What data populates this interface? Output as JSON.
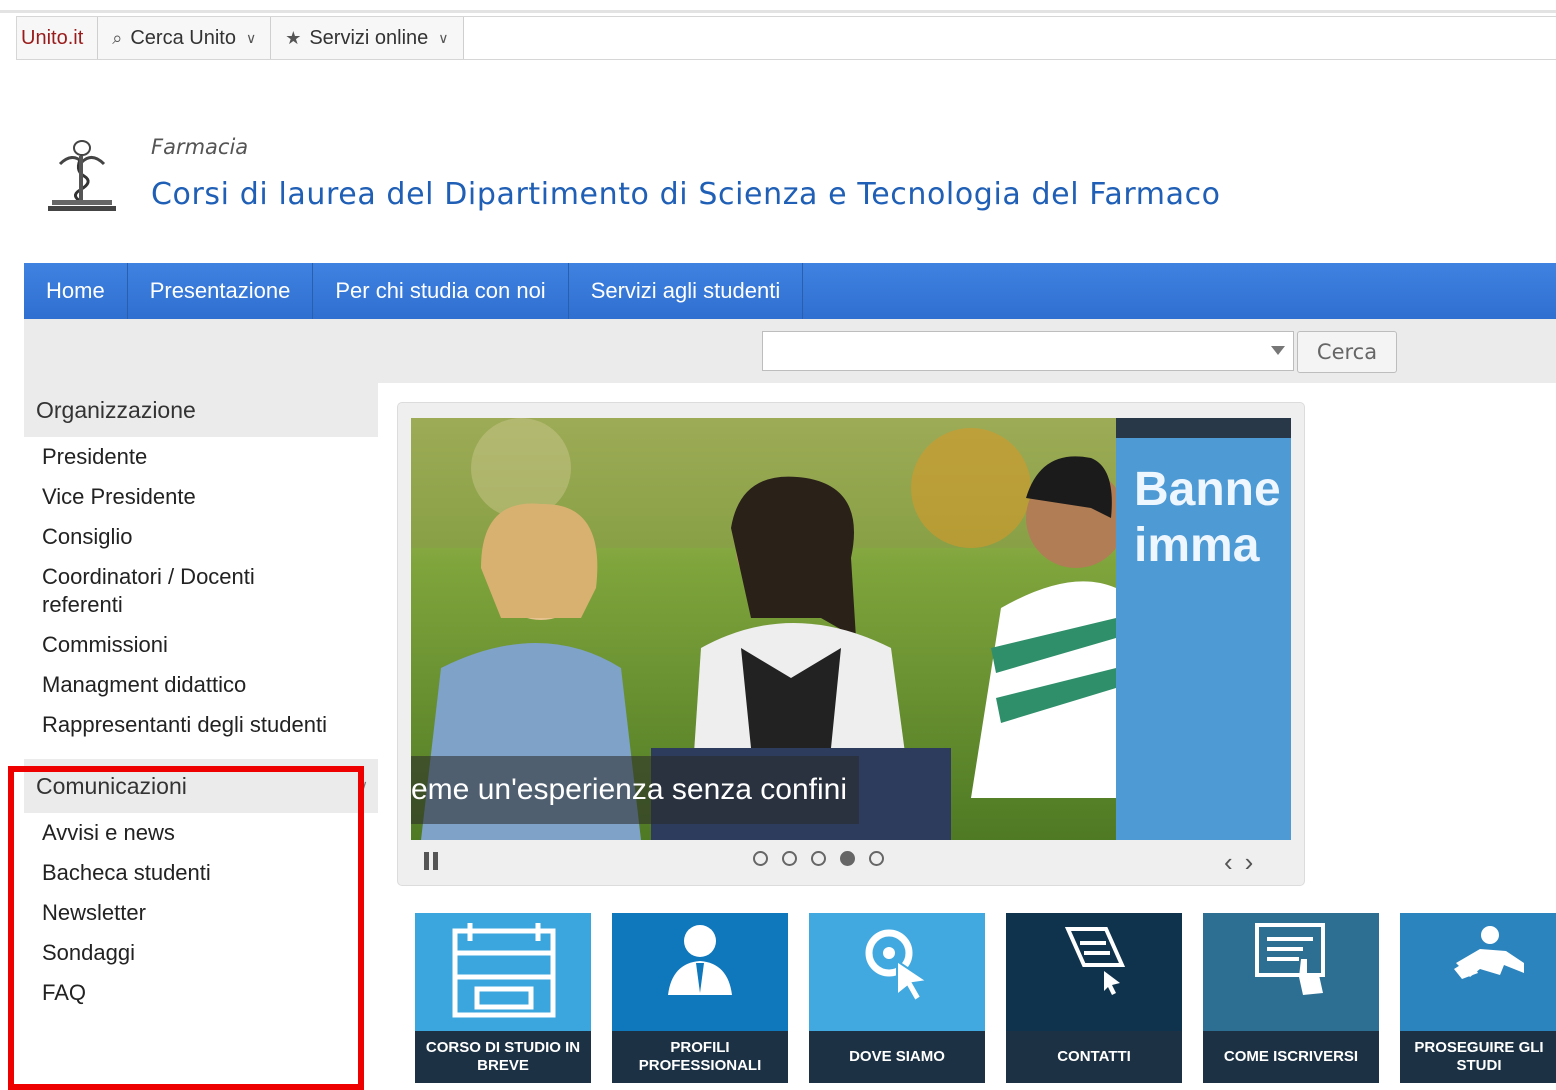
{
  "topbar": {
    "brand": "Unito.it",
    "search": "Cerca Unito",
    "services": "Servizi online"
  },
  "header": {
    "kicker": "Farmacia",
    "title": "Corsi di laurea del Dipartimento di Scienza e Tecnologia del Farmaco"
  },
  "nav": {
    "items": [
      "Home",
      "Presentazione",
      "Per chi studia con noi",
      "Servizi agli studenti"
    ]
  },
  "search": {
    "button": "Cerca"
  },
  "sidebar": {
    "organizzazione": {
      "title": "Organizzazione",
      "items": [
        "Presidente",
        "Vice Presidente",
        "Consiglio",
        "Coordinatori / Docenti referenti",
        "Commissioni",
        "Managment didattico",
        "Rappresentanti degli studenti"
      ]
    },
    "comunicazioni": {
      "title": "Comunicazioni",
      "items": [
        "Avvisi e news",
        "Bacheca studenti",
        "Newsletter",
        "Sondaggi",
        "FAQ"
      ]
    }
  },
  "slider": {
    "caption": "eme un'esperienza senza confini",
    "banner_line1": "Banne",
    "banner_line2": "imma",
    "dots": 5,
    "active_dot": 4
  },
  "tiles": [
    {
      "label": "CORSO DI STUDIO IN BREVE",
      "color": "#3aa6dd",
      "icon": "calendar-icon"
    },
    {
      "label": "PROFILI PROFESSIONALI",
      "color": "#0f78bd",
      "icon": "professional-icon"
    },
    {
      "label": "DOVE SIAMO",
      "color": "#41a9e0",
      "icon": "location-icon"
    },
    {
      "label": "CONTATTI",
      "color": "#10334d",
      "icon": "contact-icon"
    },
    {
      "label": "COME ISCRIVERSI",
      "color": "#2d6e93",
      "icon": "enroll-icon"
    },
    {
      "label": "PROSEGUIRE GLI STUDI",
      "color": "#2b84bd",
      "icon": "study-icon"
    }
  ]
}
